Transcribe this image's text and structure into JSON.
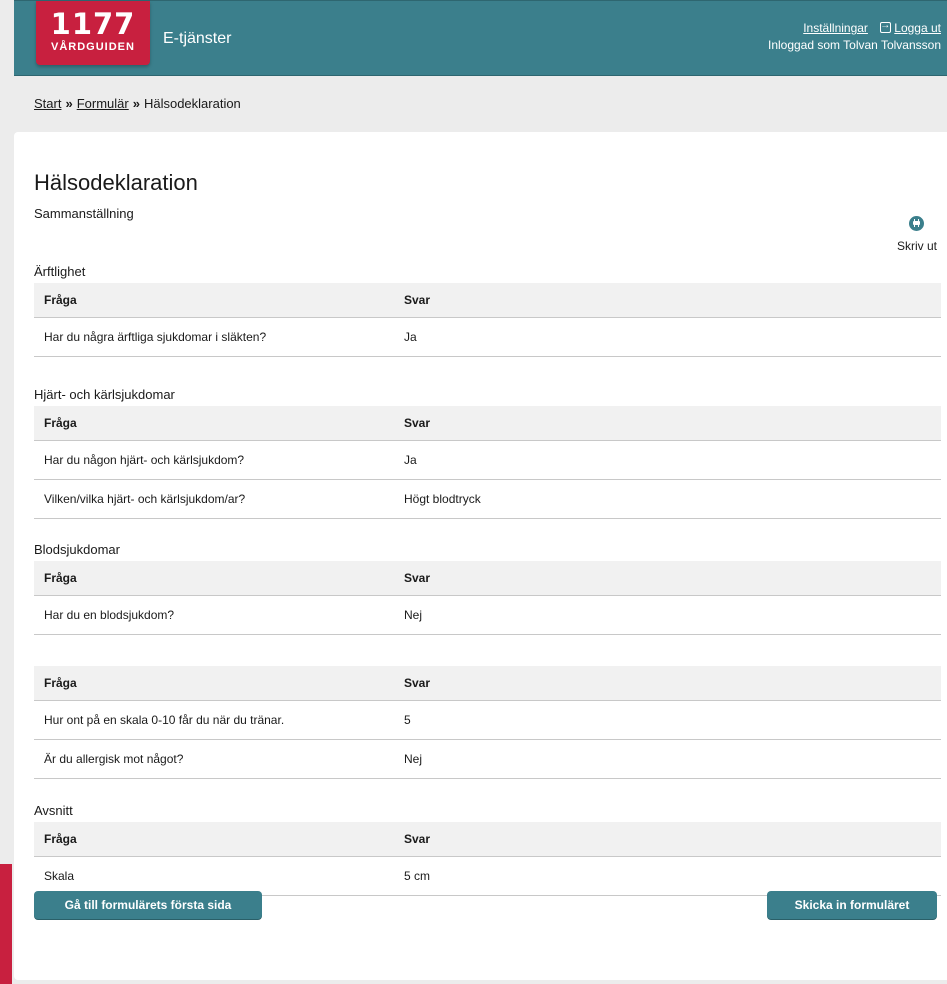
{
  "header": {
    "logo_number": "1177",
    "logo_text": "VÅRDGUIDEN",
    "app_title": "E-tjänster",
    "settings_link": "Inställningar",
    "logout_link": "Logga ut",
    "logged_in_as": "Inloggad som Tolvan Tolvansson",
    "brand_color": "#c8203f",
    "accent_color": "#3b7f8c"
  },
  "breadcrumb": {
    "items": [
      "Start",
      "Formulär",
      "Hälsodeklaration"
    ],
    "separator": "»"
  },
  "page": {
    "title": "Hälsodeklaration",
    "subtitle": "Sammanställning",
    "print_label": "Skriv ut"
  },
  "sections": [
    {
      "heading": "Ärftlighet",
      "col_question": "Fråga",
      "col_answer": "Svar",
      "rows": [
        {
          "q": "Har du några ärftliga sjukdomar i släkten?",
          "a": "Ja"
        }
      ]
    },
    {
      "heading": "Hjärt- och kärlsjukdomar",
      "col_question": "Fråga",
      "col_answer": "Svar",
      "rows": [
        {
          "q": "Har du någon hjärt- och kärlsjukdom?",
          "a": "Ja"
        },
        {
          "q": "Vilken/vilka hjärt- och kärlsjukdom/ar?",
          "a": "Högt blodtryck"
        }
      ]
    },
    {
      "heading": "Blodsjukdomar",
      "col_question": "Fråga",
      "col_answer": "Svar",
      "rows": [
        {
          "q": "Har du en blodsjukdom?",
          "a": "Nej"
        }
      ]
    },
    {
      "heading": "",
      "col_question": "Fråga",
      "col_answer": "Svar",
      "rows": [
        {
          "q": "Hur ont på en skala 0-10 får du när du tränar.",
          "a": "5"
        },
        {
          "q": "Är du allergisk mot något?",
          "a": "Nej"
        }
      ]
    },
    {
      "heading": "Avsnitt",
      "col_question": "Fråga",
      "col_answer": "Svar",
      "rows": [
        {
          "q": "Skala",
          "a": "5 cm"
        }
      ]
    }
  ],
  "buttons": {
    "first_page": "Gå till formulärets första sida",
    "submit": "Skicka in formuläret"
  }
}
